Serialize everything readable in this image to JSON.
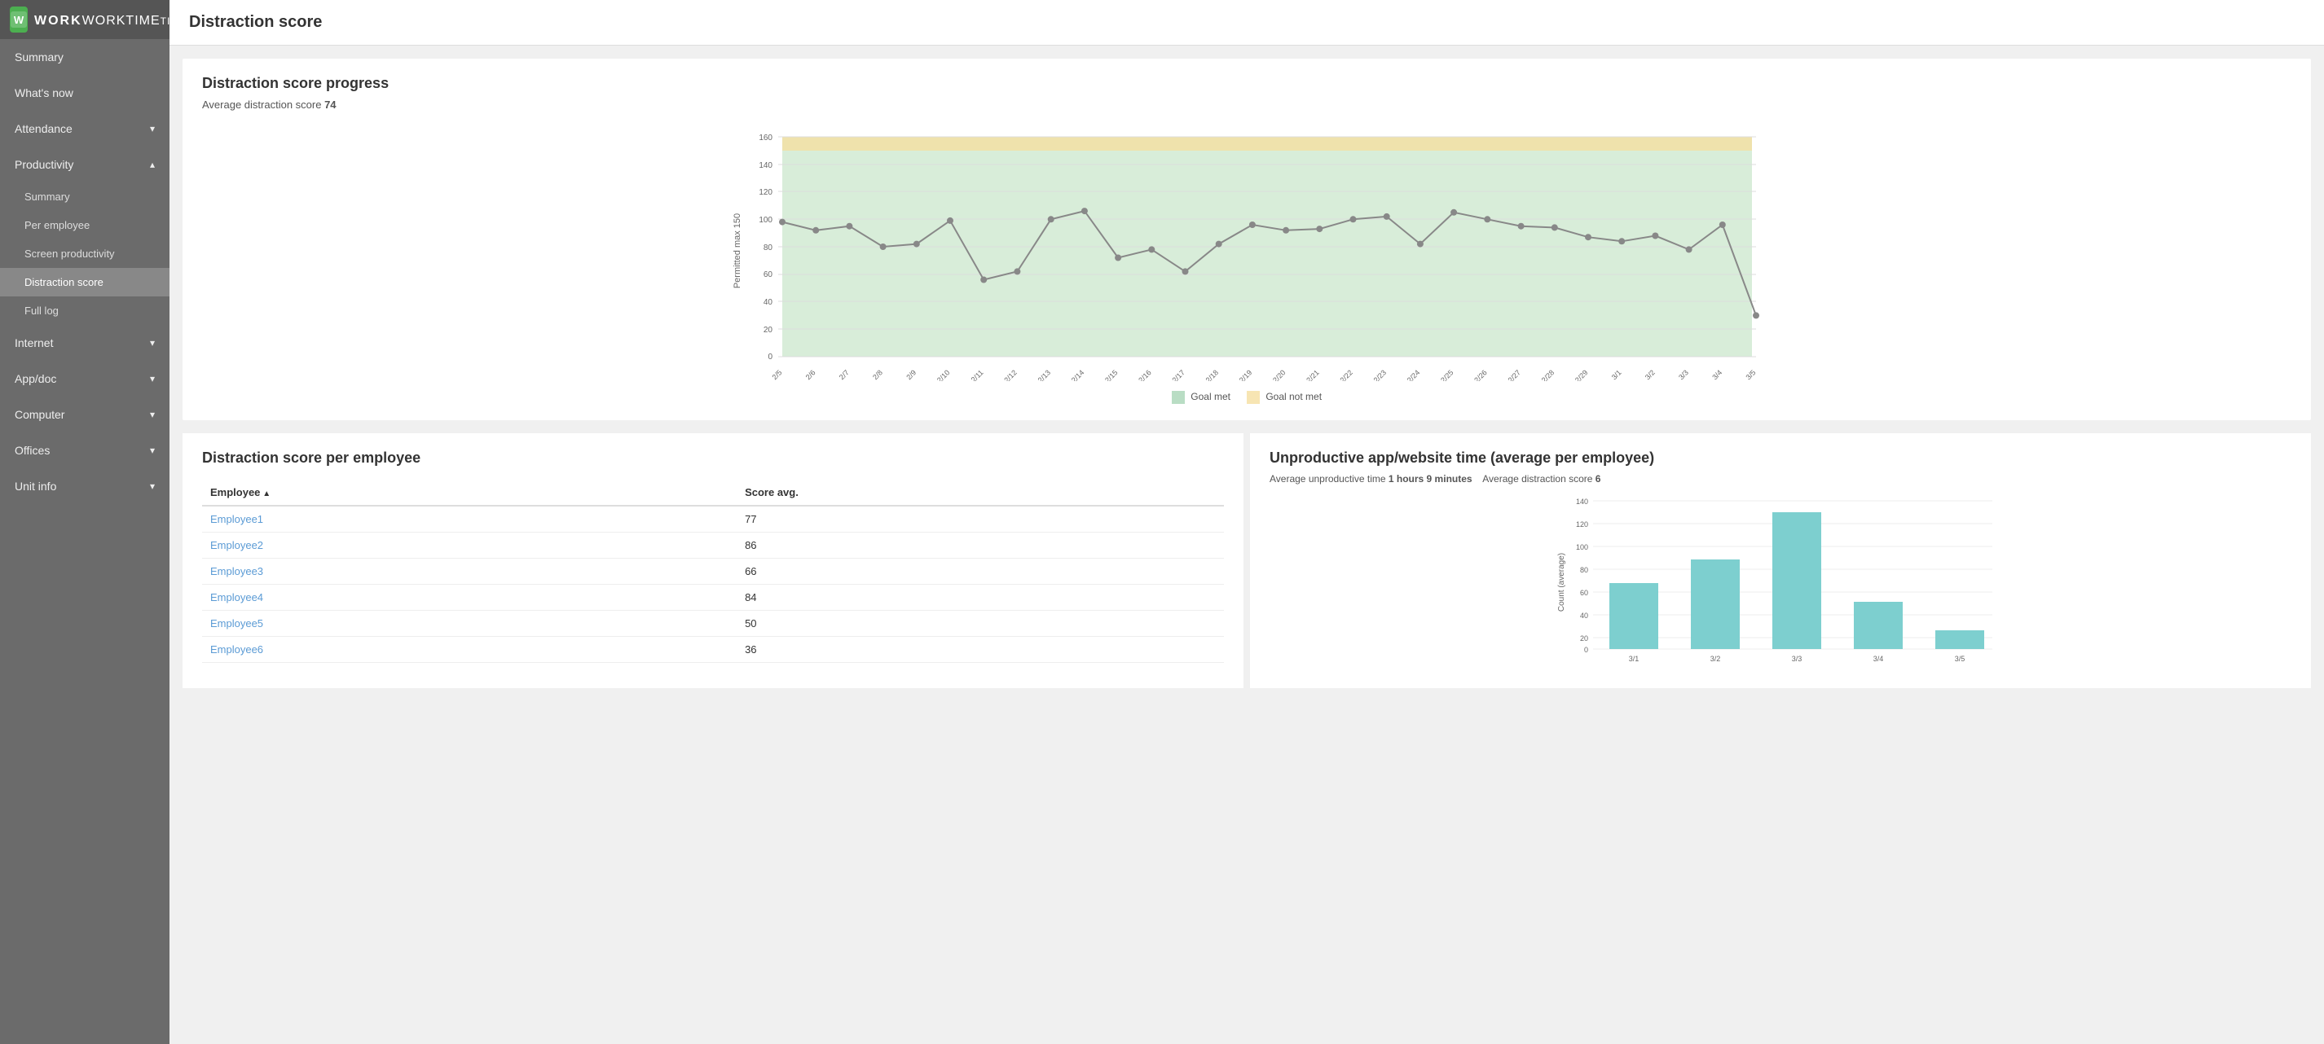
{
  "app": {
    "logo": "W",
    "logo_name": "WORKTIME",
    "logo_trademark": "®"
  },
  "page": {
    "title": "Distraction score"
  },
  "sidebar": {
    "items": [
      {
        "id": "summary",
        "label": "Summary",
        "hasChildren": false,
        "expanded": false
      },
      {
        "id": "whats-now",
        "label": "What's now",
        "hasChildren": false,
        "expanded": false
      },
      {
        "id": "attendance",
        "label": "Attendance",
        "hasChildren": true,
        "expanded": false
      },
      {
        "id": "productivity",
        "label": "Productivity",
        "hasChildren": true,
        "expanded": true
      },
      {
        "id": "internet",
        "label": "Internet",
        "hasChildren": true,
        "expanded": false
      },
      {
        "id": "appdoc",
        "label": "App/doc",
        "hasChildren": true,
        "expanded": false
      },
      {
        "id": "computer",
        "label": "Computer",
        "hasChildren": true,
        "expanded": false
      },
      {
        "id": "offices",
        "label": "Offices",
        "hasChildren": true,
        "expanded": false
      },
      {
        "id": "unit-info",
        "label": "Unit info",
        "hasChildren": true,
        "expanded": false
      }
    ],
    "productivity_children": [
      {
        "id": "prod-summary",
        "label": "Summary"
      },
      {
        "id": "per-employee",
        "label": "Per employee"
      },
      {
        "id": "screen-productivity",
        "label": "Screen productivity"
      },
      {
        "id": "distraction-score",
        "label": "Distraction score",
        "active": true
      },
      {
        "id": "full-log",
        "label": "Full log"
      }
    ]
  },
  "progress_chart": {
    "title": "Distraction score progress",
    "avg_label": "Average distraction score",
    "avg_value": "74",
    "y_label": "Permitted max 150",
    "y_max": 160,
    "y_ticks": [
      0,
      20,
      40,
      60,
      80,
      100,
      120,
      140,
      160
    ],
    "legend_goal_met": "Goal met",
    "legend_goal_not_met": "Goal not met",
    "x_labels": [
      "2/5",
      "2/6",
      "2/7",
      "2/8",
      "2/9",
      "2/10",
      "2/11",
      "2/12",
      "2/13",
      "2/14",
      "2/15",
      "2/16",
      "2/17",
      "2/18",
      "2/19",
      "2/20",
      "2/21",
      "2/22",
      "2/23",
      "2/24",
      "2/25",
      "2/26",
      "2/27",
      "2/28",
      "2/29",
      "3/1",
      "3/2",
      "3/3",
      "3/4",
      "3/5"
    ],
    "data_points": [
      98,
      92,
      95,
      80,
      82,
      99,
      56,
      62,
      100,
      106,
      72,
      78,
      62,
      82,
      96,
      92,
      93,
      100,
      102,
      82,
      105,
      100,
      95,
      94,
      87,
      84,
      88,
      78,
      96,
      30
    ]
  },
  "distraction_table": {
    "title": "Distraction score per employee",
    "col_employee": "Employee",
    "col_score": "Score avg.",
    "rows": [
      {
        "name": "Employee1",
        "score": 77
      },
      {
        "name": "Employee2",
        "score": 86
      },
      {
        "name": "Employee3",
        "score": 66
      },
      {
        "name": "Employee4",
        "score": 84
      },
      {
        "name": "Employee5",
        "score": 50
      },
      {
        "name": "Employee6",
        "score": 36
      }
    ]
  },
  "bar_chart": {
    "title": "Unproductive app/website time (average per employee)",
    "avg_time_label": "Average unproductive time",
    "avg_time_value": "1 hours 9 minutes",
    "avg_score_label": "Average distraction score",
    "avg_score_value": "6",
    "y_label": "Count (average)",
    "y_max": 140,
    "y_ticks": [
      0,
      20,
      40,
      60,
      80,
      100,
      120,
      140
    ],
    "x_labels": [
      "3/1",
      "3/2",
      "3/3",
      "3/4",
      "3/5"
    ],
    "bar_values": [
      62,
      85,
      130,
      45,
      18
    ],
    "bar_color": "#7dcfcf"
  }
}
